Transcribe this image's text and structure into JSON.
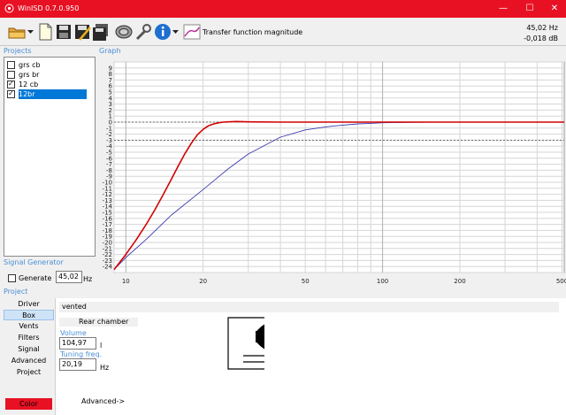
{
  "window": {
    "title": "WinISD 0.7.0.950",
    "minimize_glyph": "—",
    "maximize_glyph": "☐",
    "close_glyph": "✕"
  },
  "toolbar": {
    "icons": [
      "open-folder-icon",
      "dropdown-arrow-icon",
      "new-document-icon",
      "save-icon",
      "save-as-icon",
      "save-all-icon",
      "driver-icon",
      "tools-wrench-icon",
      "info-icon",
      "dropdown-arrow-icon",
      "graph-icon"
    ],
    "graph_selector_label": "Transfer function magnitude",
    "cursor_freq": "45,02 Hz",
    "cursor_db": "-0,018 dB"
  },
  "projects": {
    "label": "Projects",
    "items": [
      {
        "name": "grs cb",
        "checked": false,
        "selected": false
      },
      {
        "name": "grs br",
        "checked": false,
        "selected": false
      },
      {
        "name": "12 cb",
        "checked": true,
        "selected": false
      },
      {
        "name": "12br",
        "checked": true,
        "selected": true
      }
    ]
  },
  "graph": {
    "label": "Graph"
  },
  "chart_data": {
    "type": "line",
    "title": "",
    "xlabel": "",
    "ylabel": "",
    "xscale": "log",
    "xlim": [
      9,
      510
    ],
    "ylim": [
      -25,
      10
    ],
    "x_ticks": [
      10,
      20,
      50,
      100,
      200,
      500
    ],
    "y_ticks": [
      9,
      8,
      7,
      6,
      5,
      4,
      3,
      2,
      1,
      0,
      -1,
      -2,
      -3,
      -4,
      -5,
      -6,
      -7,
      -8,
      -9,
      -10,
      -11,
      -12,
      -13,
      -14,
      -15,
      -16,
      -17,
      -18,
      -19,
      -20,
      -21,
      -22,
      -23,
      -24
    ],
    "reference_lines": [
      0,
      -3
    ],
    "grid": true,
    "series": [
      {
        "color": "#d40000",
        "x": [
          9,
          10,
          11,
          12,
          13,
          14,
          15,
          16,
          17,
          18,
          19,
          20,
          21,
          22,
          23,
          24,
          25,
          27,
          30,
          40,
          50,
          70,
          100,
          150,
          200,
          300,
          400,
          510
        ],
        "y": [
          -24.5,
          -22,
          -19.5,
          -17,
          -14.5,
          -12,
          -9.6,
          -7.3,
          -5.2,
          -3.5,
          -2.1,
          -1.2,
          -0.6,
          -0.3,
          -0.1,
          0.0,
          0.05,
          0.1,
          0.05,
          0.0,
          0.0,
          0.0,
          0.0,
          0.0,
          0.0,
          0.0,
          0.0,
          0.0
        ]
      },
      {
        "color": "#3a3ab0",
        "x": [
          9,
          10,
          12,
          15,
          20,
          25,
          30,
          40,
          50,
          60,
          70,
          80,
          90,
          100,
          150,
          200,
          300,
          400,
          510
        ],
        "y": [
          -24.5,
          -22.5,
          -19.5,
          -15.5,
          -11.2,
          -7.8,
          -5.3,
          -2.5,
          -1.3,
          -0.8,
          -0.5,
          -0.3,
          -0.2,
          -0.1,
          0.0,
          0.0,
          0.0,
          0.0,
          0.0
        ]
      }
    ]
  },
  "signal_generator": {
    "label": "Signal Generator",
    "generate_label": "Generate",
    "generate_checked": false,
    "frequency": "45,02",
    "unit": "Hz"
  },
  "project_panel": {
    "label": "Project",
    "nav": [
      "Driver",
      "Box",
      "Vents",
      "Filters",
      "Signal",
      "Advanced",
      "Project"
    ],
    "selected": "Box",
    "color_label": "Color",
    "color_value": "#e81123"
  },
  "box": {
    "type": "vented",
    "chamber_label": "Rear chamber",
    "volume_label": "Volume",
    "volume_value": "104,97",
    "volume_unit": "l",
    "tuning_label": "Tuning freq.",
    "tuning_value": "20,19",
    "tuning_unit": "Hz",
    "advanced_link": "Advanced->"
  }
}
